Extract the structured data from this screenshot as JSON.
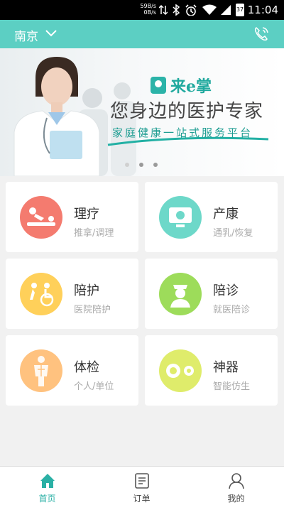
{
  "status_bar": {
    "net_up": "59B/s",
    "net_down": "0B/s",
    "battery": "37",
    "time": "11:04"
  },
  "header": {
    "city": "南京"
  },
  "banner": {
    "brand": "来e掌",
    "slogan": "您身边的医护专家",
    "tagline": "家庭健康一站式服务平台"
  },
  "services": [
    {
      "title": "理疗",
      "subtitle": "推拿/调理",
      "color": "#f47b6f"
    },
    {
      "title": "产康",
      "subtitle": "通乳/恢复",
      "color": "#6dd8c9"
    },
    {
      "title": "陪护",
      "subtitle": "医院陪护",
      "color": "#ffd05a"
    },
    {
      "title": "陪诊",
      "subtitle": "就医陪诊",
      "color": "#9ddc5a"
    },
    {
      "title": "体检",
      "subtitle": "个人/单位",
      "color": "#ffc27f"
    },
    {
      "title": "神器",
      "subtitle": "智能仿生",
      "color": "#dfec6b"
    }
  ],
  "bottom_nav": [
    {
      "label": "首页",
      "active": true
    },
    {
      "label": "订单",
      "active": false
    },
    {
      "label": "我的",
      "active": false
    }
  ],
  "colors": {
    "accent": "#5ccfc3",
    "active_tab": "#2ab0a5"
  }
}
